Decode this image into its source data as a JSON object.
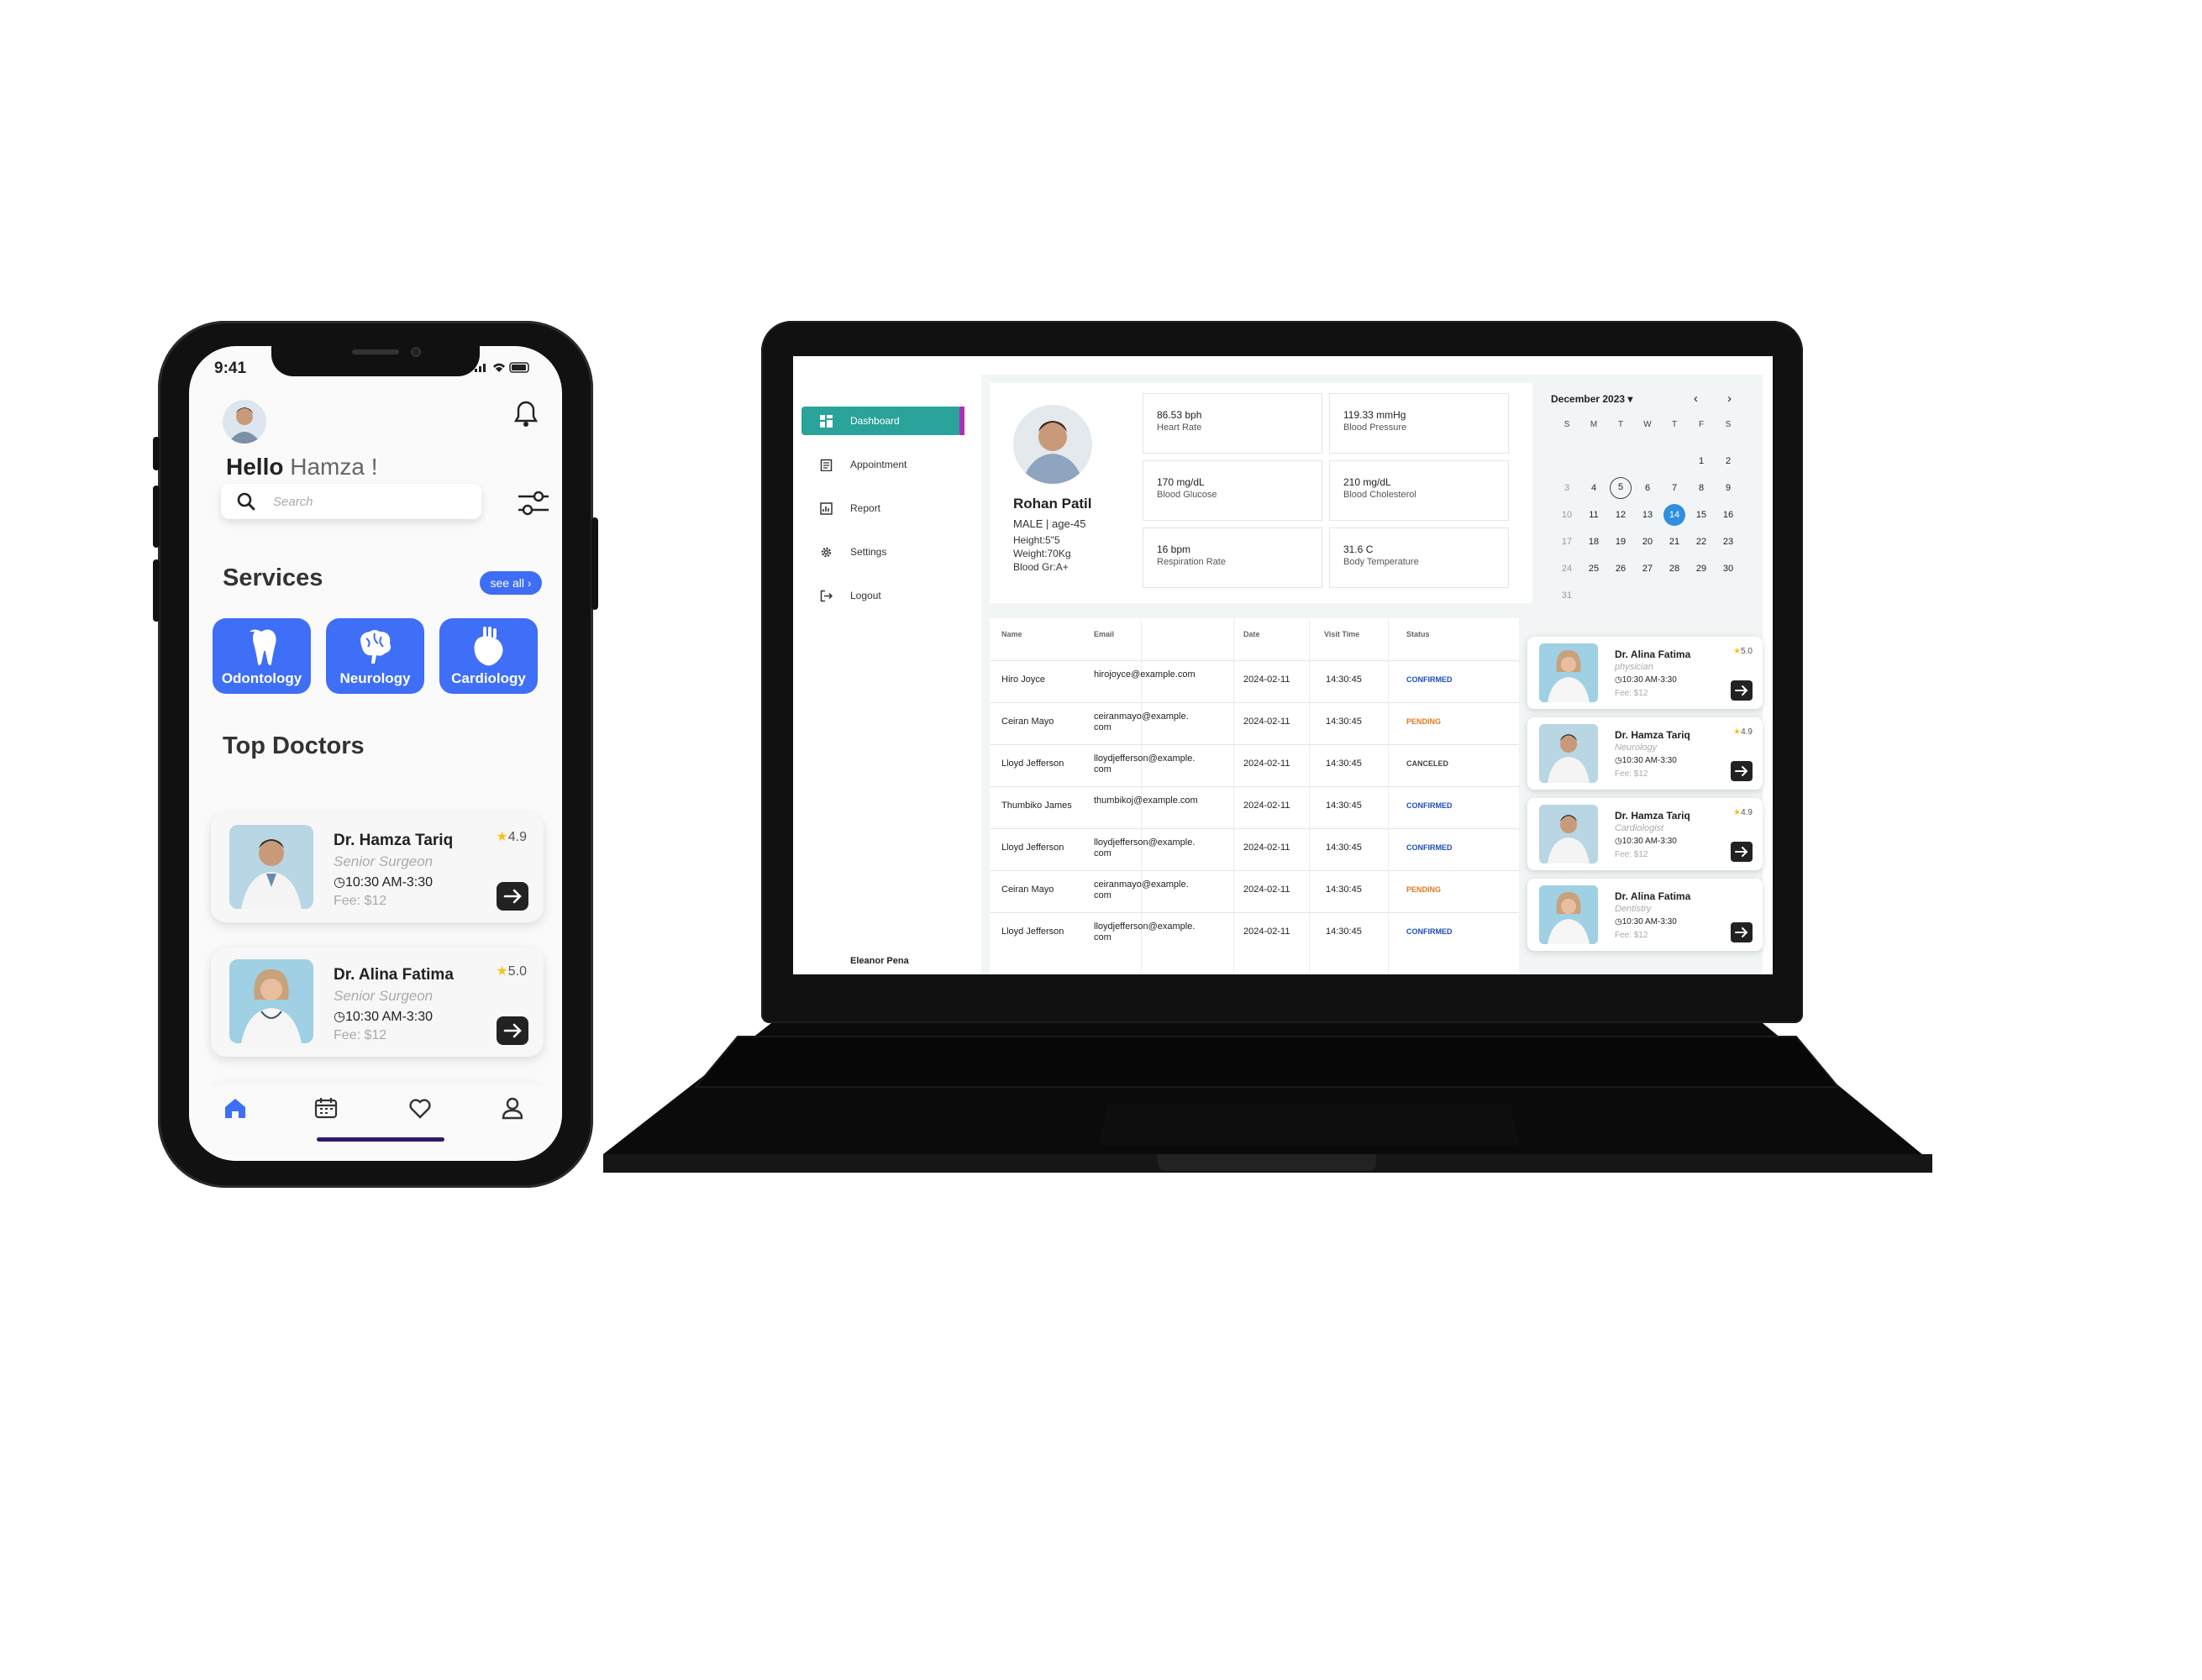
{
  "phone": {
    "status_time": "9:41",
    "greeting": "Hello",
    "user_name": "Hamza !",
    "search_placeholder": "Search",
    "services_title": "Services",
    "see_all": "see all",
    "services": [
      {
        "label": "Odontology",
        "icon": "tooth-icon"
      },
      {
        "label": "Neurology",
        "icon": "brain-icon"
      },
      {
        "label": "Cardiology",
        "icon": "heart-organ-icon"
      }
    ],
    "top_doctors_title": "Top Doctors",
    "doctors": [
      {
        "name": "Dr. Hamza Tariq",
        "role": "Senior Surgeon",
        "time": "10:30 AM-3:30",
        "fee": "Fee: $12",
        "rating": "4.9"
      },
      {
        "name": "Dr. Alina Fatima",
        "role": "Senior Surgeon",
        "time": "10:30 AM-3:30",
        "fee": "Fee: $12",
        "rating": "5.0"
      }
    ],
    "bottom_nav": [
      "home-icon",
      "calendar-icon",
      "heart-icon",
      "user-icon"
    ]
  },
  "laptop": {
    "sidebar": {
      "items": [
        {
          "label": "Dashboard",
          "icon": "grid-icon"
        },
        {
          "label": "Appointment",
          "icon": "clipboard-icon"
        },
        {
          "label": "Report",
          "icon": "chart-icon"
        },
        {
          "label": "Settings",
          "icon": "gear-icon"
        },
        {
          "label": "Logout",
          "icon": "logout-icon"
        }
      ],
      "user": "Eleanor Pena"
    },
    "patient": {
      "name": "Rohan Patil",
      "sex_age": "MALE | age-45",
      "height": "Height:5\"5",
      "weight": "Weight:70Kg",
      "blood": "Blood Gr:A+"
    },
    "vitals": [
      {
        "value": "86.53 bph",
        "label": "Heart Rate"
      },
      {
        "value": "119.33 mmHg",
        "label": "Blood Pressure"
      },
      {
        "value": "170 mg/dL",
        "label": "Blood Glucose"
      },
      {
        "value": "210 mg/dL",
        "label": "Blood Cholesterol"
      },
      {
        "value": "16 bpm",
        "label": "Respiration Rate"
      },
      {
        "value": "31.6 C",
        "label": "Body Temperature"
      }
    ],
    "calendar": {
      "month": "December  2023",
      "weekdays": [
        "S",
        "M",
        "T",
        "W",
        "T",
        "F",
        "S"
      ],
      "days": [
        [
          "",
          "",
          "",
          "",
          "",
          "1",
          "2"
        ],
        [
          "3",
          "4",
          "5",
          "6",
          "7",
          "8",
          "9"
        ],
        [
          "10",
          "11",
          "12",
          "13",
          "14",
          "15",
          "16"
        ],
        [
          "17",
          "18",
          "19",
          "20",
          "21",
          "22",
          "23"
        ],
        [
          "24",
          "25",
          "26",
          "27",
          "28",
          "29",
          "30"
        ],
        [
          "31",
          "",
          "",
          "",
          "",
          "",
          ""
        ]
      ],
      "today": "5",
      "selected": "14"
    },
    "table": {
      "headers": [
        "Name",
        "Email",
        "Date",
        "Visit Time",
        "Status"
      ],
      "rows": [
        [
          "Hiro Joyce",
          "hirojoyce@example.com",
          "2024-02-11",
          "14:30:45",
          "CONFIRMED"
        ],
        [
          "Ceiran Mayo",
          "ceiranmayo@example.\ncom",
          "2024-02-11",
          "14:30:45",
          "PENDING"
        ],
        [
          "Lloyd Jefferson",
          "lloydjefferson@example.\ncom",
          "2024-02-11",
          "14:30:45",
          "CANCELED"
        ],
        [
          "Thumbiko James",
          "thumbikoj@example.com",
          "2024-02-11",
          "14:30:45",
          "CONFIRMED"
        ],
        [
          "Lloyd Jefferson",
          "lloydjefferson@example.\ncom",
          "2024-02-11",
          "14:30:45",
          "CONFIRMED"
        ],
        [
          "Ceiran Mayo",
          "ceiranmayo@example.\ncom",
          "2024-02-11",
          "14:30:45",
          "PENDING"
        ],
        [
          "Lloyd Jefferson",
          "lloydjefferson@example.\ncom",
          "2024-02-11",
          "14:30:45",
          "CONFIRMED"
        ]
      ]
    },
    "doctors": [
      {
        "name": "Dr. Alina Fatima",
        "role": "physician",
        "time": "10:30 AM-3:30",
        "fee": "Fee: $12",
        "rating": "5.0",
        "gender": "f"
      },
      {
        "name": "Dr. Hamza Tariq",
        "role": "Neurology",
        "time": "10:30 AM-3:30",
        "fee": "Fee: $12",
        "rating": "4.9",
        "gender": "m"
      },
      {
        "name": "Dr. Hamza Tariq",
        "role": "Cardiologist",
        "time": "10:30 AM-3:30",
        "fee": "Fee: $12",
        "rating": "4.9",
        "gender": "m"
      },
      {
        "name": "Dr. Alina Fatima",
        "role": "Dentistry",
        "time": "10:30 AM-3:30",
        "fee": "Fee: $12",
        "rating": "",
        "gender": "f"
      }
    ]
  },
  "colors": {
    "brand_blue": "#3f6ef7",
    "teal": "#2aa39a",
    "confirmed": "#1a4fb8",
    "pending": "#e07a1e",
    "star": "#f6c21c"
  }
}
